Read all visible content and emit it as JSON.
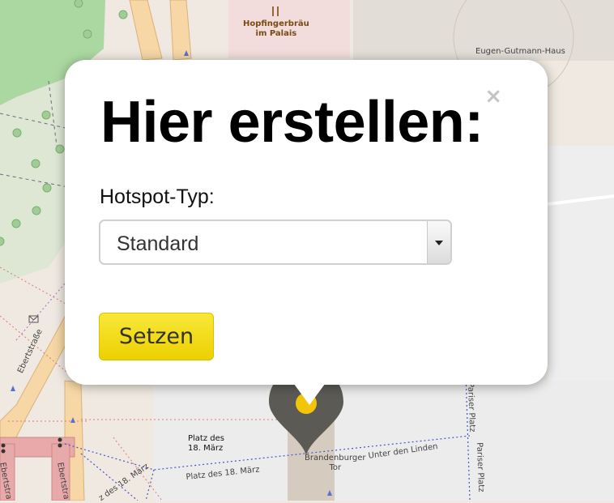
{
  "map": {
    "poi_name": "Hopfingerbräu\nim Palais",
    "building_name": "Eugen-Gutmann-Haus",
    "street_ebert_1": "Ebertstraße",
    "street_ebert_2": "Ebertstra",
    "street_ebert_3": "Ebertstra",
    "square_label": "Platz des\n18. März",
    "square_street": "Platz des 18. März",
    "square_street_2": "z des 18. März",
    "gate_label": "Brandenburger\nTor",
    "unter_den_linden": "Unter den Linden",
    "pariser_platz_1": "Pariser Platz",
    "pariser_platz_2": "Pariser Platz"
  },
  "popup": {
    "title": "Hier erstellen:",
    "close_symbol": "×",
    "hotspot_label": "Hotspot-Typ:",
    "hotspot_value": "Standard",
    "submit_label": "Setzen"
  },
  "colors": {
    "accent_yellow": "#f2d90a",
    "marker_grey": "#5b5a55"
  }
}
